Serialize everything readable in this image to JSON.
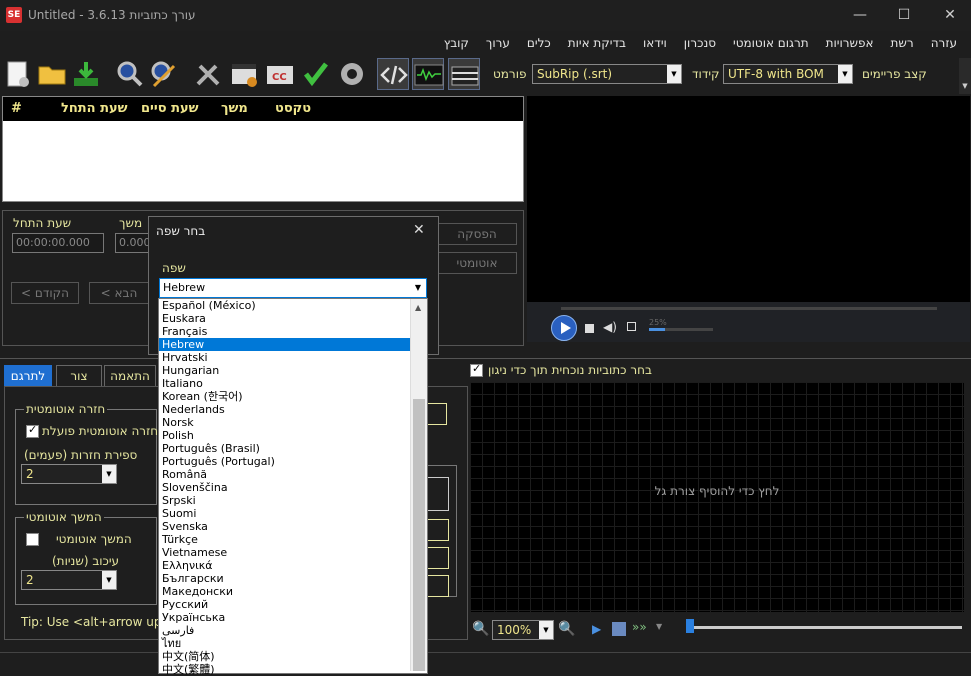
{
  "window": {
    "title": "Untitled - 3.6.13 עורך כתוביות",
    "icon_text": "SE",
    "minimize": "—",
    "maximize": "☐",
    "close": "✕"
  },
  "menu": [
    "עזרה",
    "רשת",
    "אפשרויות",
    "תרגום אוטומטי",
    "סנכרון",
    "וידאו",
    "בדיקת איות",
    "כלים",
    "ערוך",
    "קובץ"
  ],
  "toolbar": {
    "icons": [
      "new-file-icon",
      "open-folder-icon",
      "download-icon",
      "find-icon",
      "replace-icon",
      "tools-icon",
      "visual-sync-icon",
      "spell-check-cc-icon",
      "check-icon",
      "settings-icon",
      "source-view-icon",
      "waveform-icon",
      "video-clapper-icon"
    ],
    "format_label": "פורמט",
    "format_value": "SubRip (.srt)",
    "encoding_label": "קידוד",
    "encoding_value": "UTF-8 with BOM",
    "framerate_label": "קצב פריימים"
  },
  "grid": {
    "columns": [
      "#",
      "שעת התחל",
      "שעת סיים",
      "משך",
      "טקסט"
    ]
  },
  "edit_panel": {
    "start_label": "שעת התחל",
    "start_value": "00:00:00.000",
    "duration_label": "משך",
    "duration_value": "0.000",
    "pause_btn": "הפסקה",
    "auto_btn": "אוטומטי",
    "prev_btn": "< הקודם",
    "next_btn": "< הבא"
  },
  "video_ctrl": {
    "volume": "25%"
  },
  "tabs": [
    "לתרגם",
    "צור",
    "התאמה"
  ],
  "translate_tab": {
    "auto_repeat_group": "חזרה אוטומטית",
    "auto_repeat_on": "חזרה אוטומטית פועלת",
    "repeat_count_label": "ספירת חזרות (פעמים)",
    "repeat_count_value": "2",
    "auto_continue_group": "המשך אוטומטי",
    "auto_continue": "המשך אוטומטי",
    "delay_label": "עיכוב (שניות)",
    "delay_value": "2",
    "tip": "Tip: Use <alt+arrow up/do"
  },
  "waveform": {
    "select_current_label": "בחר כתוביות נוכחית תוך כדי ניגון",
    "placeholder": "לחץ כדי להוסיף צורת גל",
    "zoom_value": "100%"
  },
  "dialog": {
    "title": "בחר שפה",
    "close": "✕",
    "language_label": "שפה",
    "language_value": "Hebrew",
    "options": [
      "Español (México)",
      "Euskara",
      "Français",
      "Hebrew",
      "Hrvatski",
      "Hungarian",
      "Italiano",
      "Korean (한국어)",
      "Nederlands",
      "Norsk",
      "Polish",
      "Português (Brasil)",
      "Português (Portugal)",
      "Română",
      "Slovenščina",
      "Srpski",
      "Suomi",
      "Svenska",
      "Türkçe",
      "Vietnamese",
      "Ελληνικά",
      "Български",
      "Македонски",
      "Русский",
      "Українська",
      "فارسی",
      "ไทย",
      "中文(简体)",
      "中文(繁體)"
    ],
    "selected_index": 3
  }
}
